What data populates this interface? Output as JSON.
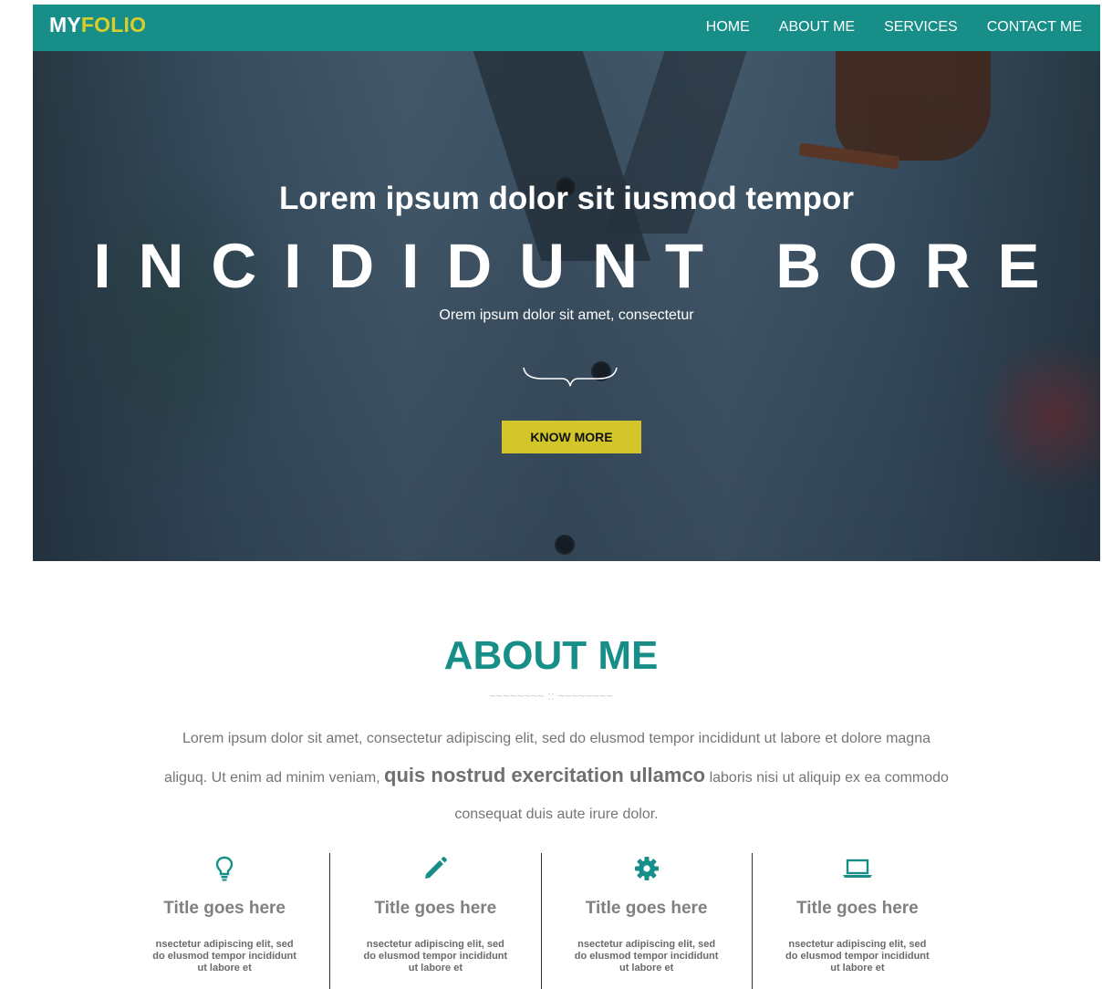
{
  "brand": {
    "logo_part1": "MY",
    "logo_part2": "FOLIO",
    "primary_color": "#178e88",
    "accent_color": "#d2c62a"
  },
  "nav": {
    "items": [
      {
        "label": "HOME"
      },
      {
        "label": "ABOUT ME"
      },
      {
        "label": "SERVICES"
      },
      {
        "label": "CONTACT ME"
      }
    ]
  },
  "hero": {
    "subtitle": "Lorem ipsum dolor sit iusmod tempor",
    "title": "INCIDIDUNT BORE",
    "tagline": "Orem ipsum dolor sit amet, consectetur",
    "button_label": "KNOW MORE"
  },
  "about": {
    "title": "ABOUT ME",
    "divider": "~~~~~~~~ :: ~~~~~~~~",
    "text_part1": "Lorem ipsum dolor sit amet, consectetur adipiscing elit, sed do elusmod tempor incididunt ut labore et dolore magna aliguq. Ut enim ad minim veniam,",
    "text_emphasis": "quis nostrud exercitation ullamco",
    "text_part2": "laboris nisi ut aliquip ex ea commodo consequat duis aute irure dolor.",
    "features": [
      {
        "icon": "lightbulb-icon",
        "title": "Title goes here",
        "desc": "nsectetur adipiscing elit, sed do elusmod tempor incididunt ut labore et"
      },
      {
        "icon": "pencil-icon",
        "title": "Title goes here",
        "desc": "nsectetur adipiscing elit, sed do elusmod tempor incididunt ut labore et"
      },
      {
        "icon": "gear-icon",
        "title": "Title goes here",
        "desc": "nsectetur adipiscing elit, sed do elusmod tempor incididunt ut labore et"
      },
      {
        "icon": "laptop-icon",
        "title": "Title goes here",
        "desc": "nsectetur adipiscing elit, sed do elusmod tempor incididunt ut labore et"
      }
    ]
  }
}
